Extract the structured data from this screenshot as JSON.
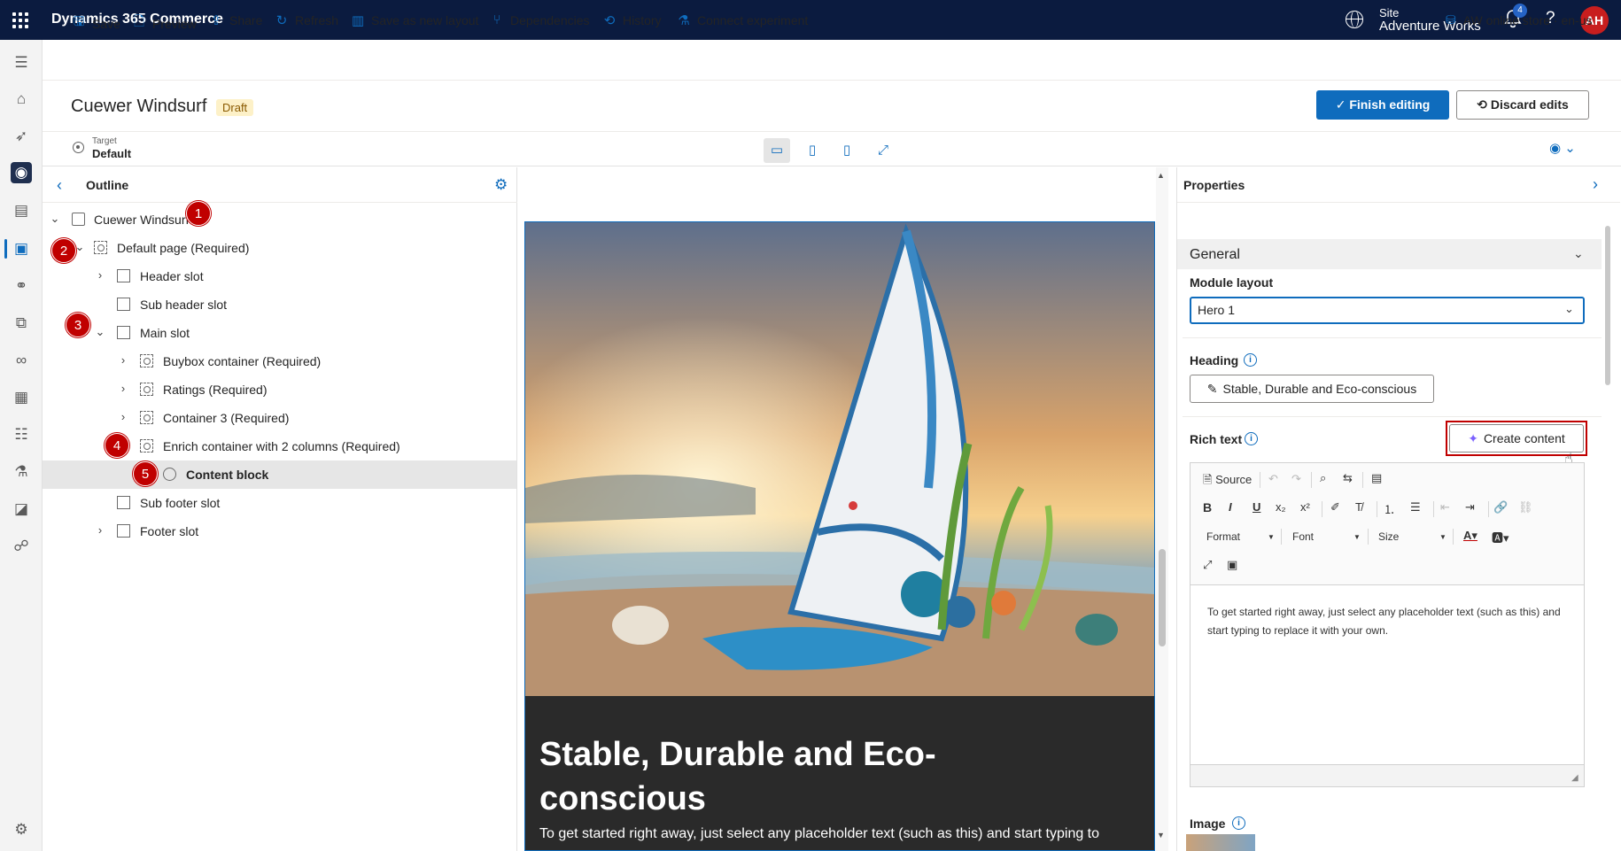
{
  "header": {
    "app_title": "Dynamics 365 Commerce",
    "site_label": "Site",
    "site_name": "Adventure Works",
    "notification_count": "4",
    "help_glyph": "?",
    "avatar_initials": "AH"
  },
  "commands": {
    "save": "Save",
    "preview": "Preview",
    "share": "Share",
    "refresh": "Refresh",
    "save_as_layout": "Save as new layout",
    "dependencies": "Dependencies",
    "history": "History",
    "connect_experiment": "Connect experiment",
    "store": "AW online store · en-us"
  },
  "page": {
    "title": "Cuewer Windsurf",
    "status": "Draft",
    "finish_label": "Finish editing",
    "discard_label": "Discard edits"
  },
  "target": {
    "label": "Target",
    "value": "Default"
  },
  "outline": {
    "title": "Outline",
    "nodes": [
      {
        "label": "Cuewer Windsurf"
      },
      {
        "label": "Default page (Required)"
      },
      {
        "label": "Header slot"
      },
      {
        "label": "Sub header slot"
      },
      {
        "label": "Main slot"
      },
      {
        "label": "Buybox container (Required)"
      },
      {
        "label": "Ratings (Required)"
      },
      {
        "label": "Container 3 (Required)"
      },
      {
        "label": "Enrich container with 2 columns (Required)"
      },
      {
        "label": "Content block"
      },
      {
        "label": "Sub footer slot"
      },
      {
        "label": "Footer slot"
      }
    ],
    "more_glyph": "···"
  },
  "markers": [
    "1",
    "2",
    "3",
    "4",
    "5",
    "6"
  ],
  "preview": {
    "heading": "Stable, Durable and Eco-conscious",
    "body": "To get started right away, just select any placeholder text (such as this) and start typing to"
  },
  "properties": {
    "title": "Properties",
    "section": "General",
    "module_layout_label": "Module layout",
    "module_layout_value": "Hero 1",
    "heading_label": "Heading",
    "heading_value": "Stable, Durable and Eco-conscious",
    "rich_text_label": "Rich text",
    "create_content_label": "Create content",
    "rte_source": "Source",
    "rte_format": "Format",
    "rte_font": "Font",
    "rte_size": "Size",
    "rte_text": "To get started right away, just select any placeholder text (such as this) and start typing to replace it with your own.",
    "image_label": "Image",
    "info_glyph": "i"
  },
  "colors": {
    "header_bg": "#0b1b3f",
    "accent": "#0f6cbd",
    "marker": "#c00000",
    "draft_badge": "#fdf1c8"
  }
}
